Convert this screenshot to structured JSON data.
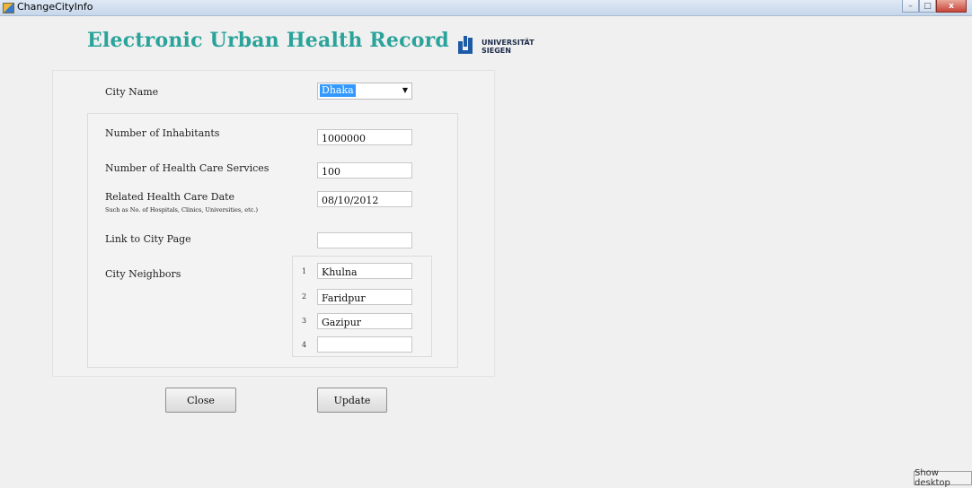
{
  "window": {
    "title": "ChangeCityInfo",
    "controls": {
      "minimize": "–",
      "maximize": "□",
      "close": "x"
    }
  },
  "header": {
    "title": "Electronic Urban Health Record",
    "logo_line1": "UNIVERSITÄT",
    "logo_line2": "SIEGEN"
  },
  "form": {
    "city_name_label": "City Name",
    "city_name_value": "Dhaka",
    "inhabitants_label": "Number of Inhabitants",
    "inhabitants_value": "1000000",
    "health_services_label": "Number of Health Care Services",
    "health_services_value": "100",
    "related_date_label": "Related Health Care Date",
    "related_date_sublabel": "Such as No. of Hospitals, Clinics, Universities, etc.)",
    "related_date_value": "08/10/2012",
    "link_label": "Link to City Page",
    "link_value": "",
    "neighbors_label": "City Neighbors",
    "neighbors": [
      {
        "num": "1",
        "value": "Khulna"
      },
      {
        "num": "2",
        "value": "Faridpur"
      },
      {
        "num": "3",
        "value": "Gazipur"
      },
      {
        "num": "4",
        "value": ""
      }
    ]
  },
  "buttons": {
    "close": "Close",
    "update": "Update"
  },
  "taskbar": {
    "show_desktop": "Show desktop"
  },
  "colors": {
    "title": "#2aa39a",
    "selection": "#3399ff",
    "logo": "#1d5aa6"
  }
}
